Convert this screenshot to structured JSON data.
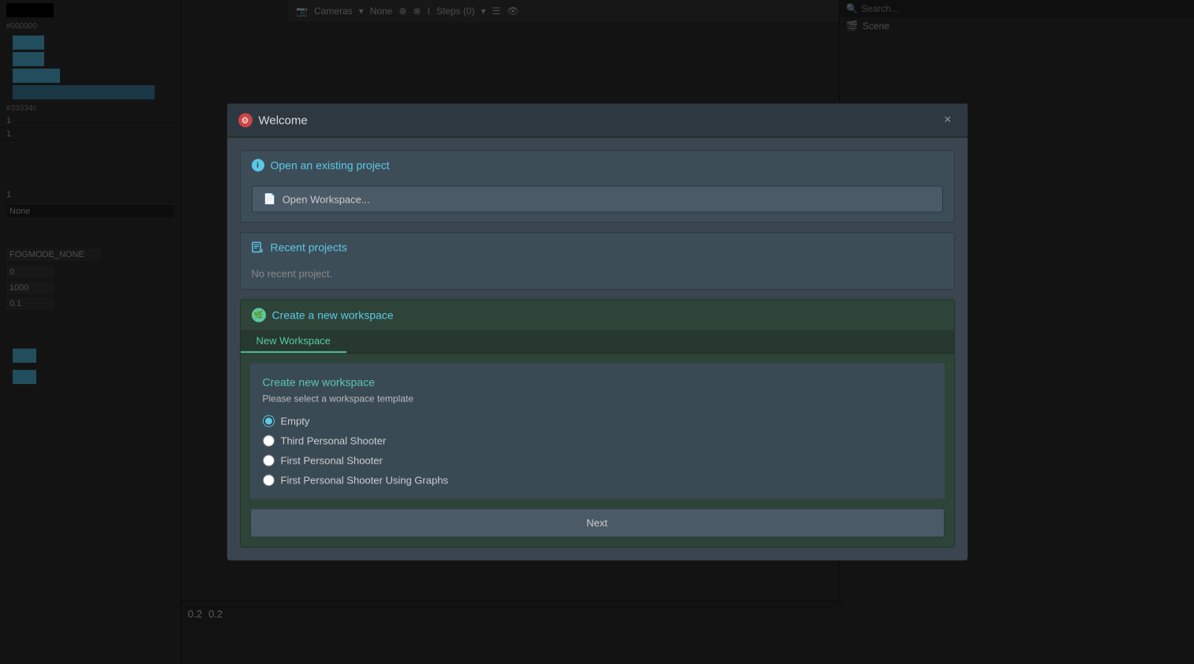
{
  "app": {
    "title": "Welcome",
    "close_label": "×"
  },
  "topbar": {
    "cameras_label": "Cameras",
    "none_label": "None",
    "steps_label": "Steps (0)"
  },
  "right_panel": {
    "search_placeholder": "Search...",
    "scene_label": "Scene"
  },
  "left_panel": {
    "color1": "#000000",
    "color1_label": "#000000",
    "color2_label": "#33334c",
    "number1": "1",
    "number2": "1",
    "number3": "1",
    "select_none": "None",
    "fog_mode": "FOGMODE_NONE",
    "num_0": "0",
    "num_1000": "1000",
    "num_01": "0.1",
    "num_02a": "0.2",
    "num_02b": "0.2"
  },
  "modal": {
    "icon": "⚙",
    "title": "Welcome",
    "close": "×",
    "sections": {
      "open_project": {
        "icon": "i",
        "title": "Open an existing project",
        "open_workspace_btn": "Open Workspace..."
      },
      "recent_projects": {
        "title": "Recent projects",
        "no_recent": "No recent project."
      },
      "create_workspace": {
        "title": "Create a new workspace",
        "tab": "New Workspace",
        "form_title": "Create new workspace",
        "form_subtitle": "Please select a workspace template",
        "templates": [
          {
            "id": "empty",
            "label": "Empty",
            "checked": true
          },
          {
            "id": "third-ps",
            "label": "Third Personal Shooter",
            "checked": false
          },
          {
            "id": "first-ps",
            "label": "First Personal Shooter",
            "checked": false
          },
          {
            "id": "first-ps-graphs",
            "label": "First Personal Shooter Using Graphs",
            "checked": false
          }
        ],
        "next_btn": "Next"
      }
    }
  }
}
